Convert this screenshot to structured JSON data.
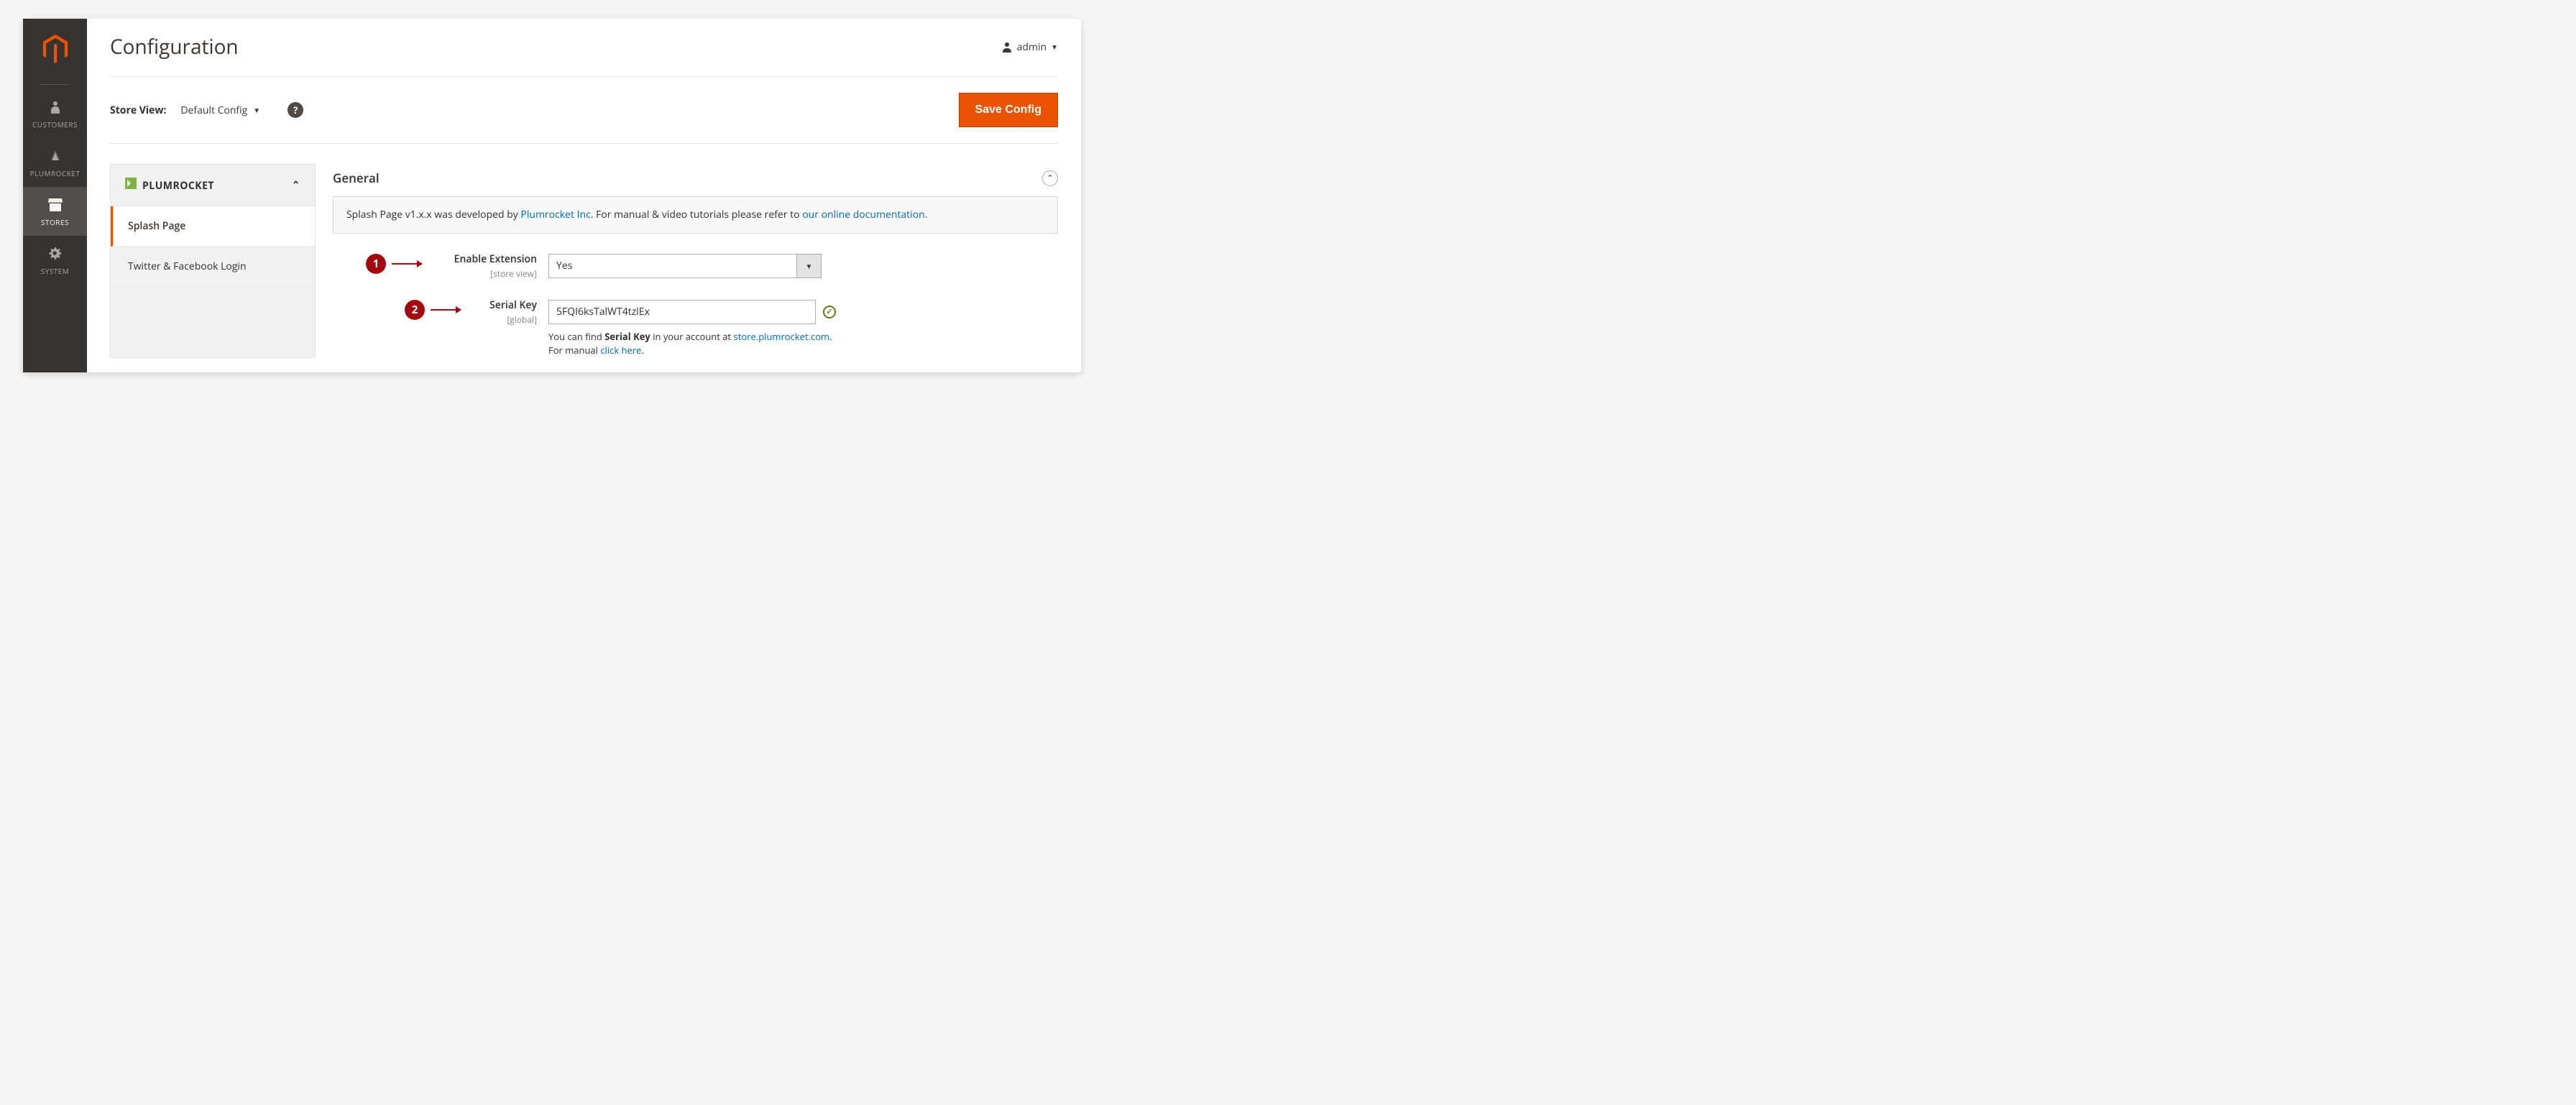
{
  "sidebar": {
    "items": [
      {
        "label": "CUSTOMERS"
      },
      {
        "label": "PLUMROCKET"
      },
      {
        "label": "STORES"
      },
      {
        "label": "SYSTEM"
      }
    ]
  },
  "header": {
    "title": "Configuration",
    "user": "admin"
  },
  "toolbar": {
    "store_view_label": "Store View:",
    "store_view_value": "Default Config",
    "save_label": "Save Config"
  },
  "configNav": {
    "group": "PLUMROCKET",
    "items": [
      {
        "label": "Splash Page"
      },
      {
        "label": "Twitter & Facebook Login"
      }
    ]
  },
  "section": {
    "title": "General",
    "info": {
      "pre": "Splash Page v1.x.x was developed by ",
      "link1": "Plumrocket Inc",
      "mid": ". For manual & video tutorials please refer to ",
      "link2": "our online documentation",
      "post": "."
    }
  },
  "fields": {
    "enable": {
      "label": "Enable Extension",
      "scope": "[store view]",
      "value": "Yes"
    },
    "serial": {
      "label": "Serial Key",
      "scope": "[global]",
      "value": "5FQI6ksTalWT4tzlEx",
      "note_pre": "You can find ",
      "note_strong": "Serial Key",
      "note_mid": " in your account at ",
      "note_link1": "store.plumrocket.com",
      "note_mid2": ". For manual ",
      "note_link2": "click here",
      "note_post": "."
    }
  },
  "annotations": {
    "one": "1",
    "two": "2"
  }
}
